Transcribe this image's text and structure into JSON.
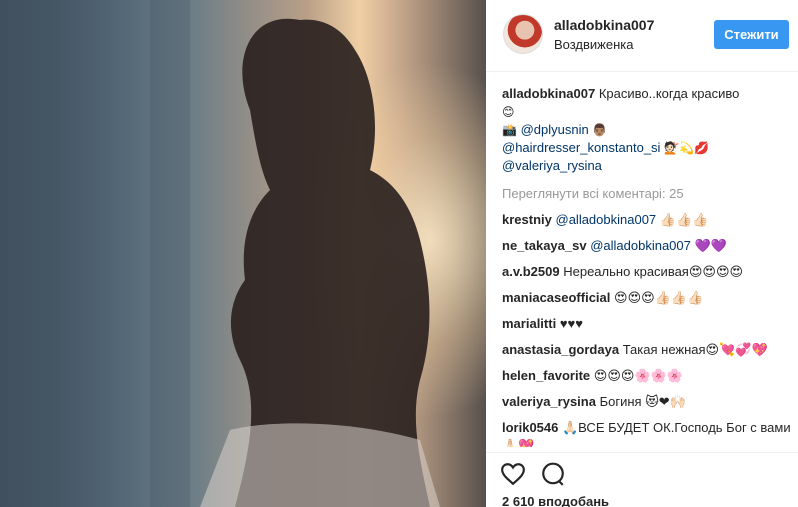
{
  "post": {
    "username": "alladobkina007",
    "location": "Воздвиженка",
    "follow_label": "Стежити"
  },
  "caption": {
    "username": "alladobkina007",
    "text": "Красиво..когда красиво",
    "emoji": "😊",
    "credits_icon": "📸",
    "credit_1": "@dplyusnin",
    "credit_1_emoji": "👨🏽",
    "credit_2": "@hairdresser_konstanto_si",
    "credit_2_emoji": "💇🏻💫💋",
    "credit_3": "@valeriya_rysina"
  },
  "view_all": "Переглянути всі коментарі: 25",
  "comments": [
    {
      "user": "krestniy",
      "mention": "@alladobkina007",
      "text": "👍🏻👍🏻👍🏻"
    },
    {
      "user": "ne_takaya_sv",
      "mention": "@alladobkina007",
      "text": "💜💜"
    },
    {
      "user": "a.v.b2509",
      "mention": "",
      "text": "Нереально красивая😍😍😍😍"
    },
    {
      "user": "maniacaseofficial",
      "mention": "",
      "text": "😍😍😍👍🏻👍🏻👍🏻"
    },
    {
      "user": "marialitti",
      "mention": "",
      "text": "♥♥♥"
    },
    {
      "user": "anastasia_gordaya",
      "mention": "",
      "text": "Такая нежная😍💘💞💖"
    },
    {
      "user": "helen_favorite",
      "mention": "",
      "text": "😍😍😍🌸🌸🌸"
    },
    {
      "user": "valeriya_rysina",
      "mention": "",
      "text": "Богиня 😻❤🙌🏻"
    },
    {
      "user": "lorik0546",
      "mention": "",
      "text": "🙏🏻ВСЕ БУДЕТ ОК.Господь Бог с вами🙏🏻💖"
    }
  ],
  "likes": "2 610 вподобань",
  "icons": {
    "like": "heart-outline-icon",
    "comment": "speech-bubble-icon"
  },
  "colors": {
    "accent": "#3897f0",
    "link": "#003569",
    "muted": "#999999"
  }
}
